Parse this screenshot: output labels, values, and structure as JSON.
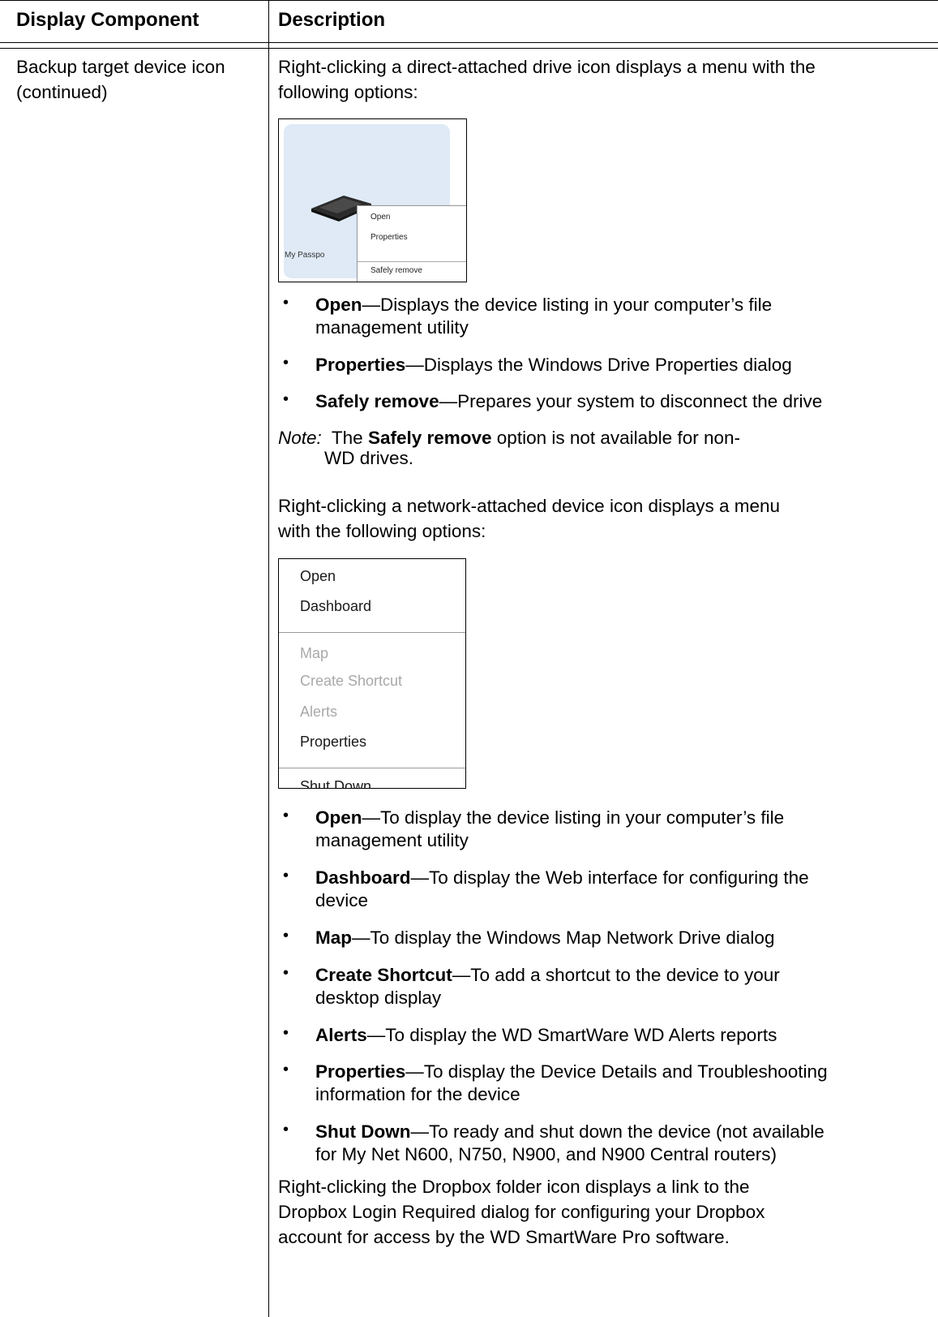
{
  "table": {
    "header": {
      "col1": "Display Component",
      "col2": "Description"
    },
    "row": {
      "component_line1": "Backup target device icon",
      "component_line2": "(continued)",
      "intro_direct_line1": "Right-clicking a direct-attached drive icon displays a menu with the",
      "intro_direct_line2": "following options:",
      "direct_menu_screenshot": {
        "tile_label": "My Passpo",
        "items": [
          "Open",
          "Properties",
          "Safely remove"
        ]
      },
      "direct_options": [
        {
          "term": "Open",
          "desc_line1": "—Displays the device listing in your computer’s file",
          "desc_line2": "management utility"
        },
        {
          "term": "Properties",
          "desc_line1": "—Displays the Windows Drive Properties dialog"
        },
        {
          "term": "Safely remove",
          "desc_line1": "—Prepares your system to disconnect the drive"
        }
      ],
      "note": {
        "label": "Note:",
        "pre": "The",
        "term": "Safely remove",
        "post": "option is not available for non-",
        "line2": "WD drives."
      },
      "intro_network_line1": "Right-clicking a network-attached device icon displays a menu",
      "intro_network_line2": "with the following options:",
      "network_menu_screenshot": {
        "items": [
          {
            "label": "Open",
            "enabled": true
          },
          {
            "label": "Dashboard",
            "enabled": true
          },
          {
            "label": "Map",
            "enabled": false
          },
          {
            "label": "Create Shortcut",
            "enabled": false
          },
          {
            "label": "Alerts",
            "enabled": false
          },
          {
            "label": "Properties",
            "enabled": true
          },
          {
            "label": "Shut Down",
            "enabled": true
          }
        ]
      },
      "network_options": [
        {
          "term": "Open",
          "desc_line1": "—To display the device listing in your computer’s file",
          "desc_line2": "management utility"
        },
        {
          "term": "Dashboard",
          "desc_line1": "—To display the Web interface for configuring the",
          "desc_line2": "device"
        },
        {
          "term": "Map",
          "desc_line1": "—To display the Windows Map Network Drive dialog"
        },
        {
          "term": "Create Shortcut",
          "desc_line1": "—To add a shortcut to the device to your",
          "desc_line2": "desktop display"
        },
        {
          "term": "Alerts",
          "desc_line1": "—To display the WD SmartWare WD Alerts reports"
        },
        {
          "term": "Properties",
          "desc_line1": "—To display the Device Details and Troubleshooting",
          "desc_line2": "information for the device"
        },
        {
          "term": "Shut Down",
          "desc_line1": "—To ready and shut down the device (not available",
          "desc_line2": "for My Net N600, N750, N900, and N900 Central routers)"
        }
      ],
      "dropbox_line1": "Right-clicking the Dropbox folder icon displays a link to the",
      "dropbox_line2": "Dropbox Login Required dialog for configuring your Dropbox",
      "dropbox_line3": "account for access by the WD SmartWare Pro software."
    }
  }
}
